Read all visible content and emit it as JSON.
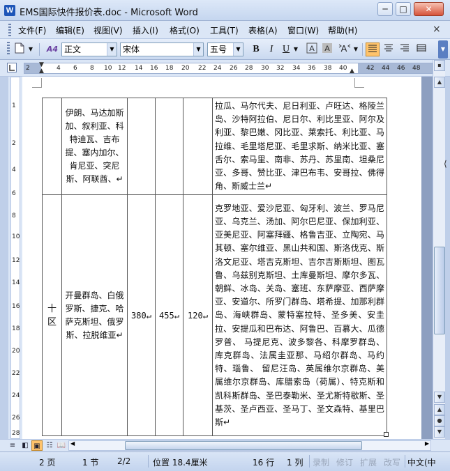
{
  "window": {
    "title": "EMS国际快件报价表.doc - Microsoft Word",
    "app_icon": "W"
  },
  "window_controls": {
    "minimize": "─",
    "maximize": "□",
    "close": "✕"
  },
  "menu": {
    "items": [
      "文件(F)",
      "编辑(E)",
      "视图(V)",
      "插入(I)",
      "格式(O)",
      "工具(T)",
      "表格(A)",
      "窗口(W)",
      "帮助(H)"
    ],
    "close_doc": "×"
  },
  "toolbar": {
    "style_value": "正文",
    "font_value": "宋体",
    "size_value": "五号",
    "bold": "B",
    "italic": "I",
    "underline": "U",
    "styles_icon": "A4"
  },
  "ruler": {
    "h_ticks": [
      "2",
      "2",
      "4",
      "6",
      "8",
      "10",
      "12",
      "14",
      "16",
      "18",
      "20",
      "22",
      "24",
      "26",
      "28",
      "30",
      "32",
      "34",
      "36",
      "38",
      "40",
      "42",
      "44",
      "46",
      "48"
    ],
    "v_ticks": [
      "1",
      "2",
      "4",
      "6",
      "8",
      "10",
      "12",
      "14",
      "16",
      "18",
      "20",
      "22",
      "24",
      "26",
      "28"
    ]
  },
  "table": {
    "row1": {
      "countries": "伊朗、马达加斯加、叙利亚、科特迪瓦、吉布提、塞内加尔、肯尼亚、突尼斯、阿联酋、↵",
      "destinations": "拉瓜、马尔代夫、尼日利亚、卢旺达、格陵兰岛、沙特阿拉伯、尼日尔、利比里亚、阿尔及利亚、黎巴嫩、冈比亚、莱索托、利比亚、马拉维、毛里塔尼亚、毛里求斯、纳米比亚、塞舌尔、索马里、南非、苏丹、苏里南、坦桑尼亚、多哥、赞比亚、津巴布韦、安哥拉、佛得角、斯威士兰↵"
    },
    "row2": {
      "zone": "十区",
      "countries": "开曼群岛、白俄罗斯、捷克、哈萨克斯坦、俄罗斯、拉脱维亚↵",
      "price1": "380↵",
      "price2": "455↵",
      "price3": "120↵",
      "destinations": "克罗地亚、爱沙尼亚、匈牙利、波兰、罗马尼亚、乌克兰、汤加、阿尔巴尼亚、保加利亚、亚美尼亚、阿塞拜疆、格鲁吉亚、立陶宛、马其顿、塞尔维亚、黑山共和国、斯洛伐克、斯洛文尼亚、塔吉克斯坦、吉尔吉斯斯坦、图瓦鲁、乌兹别克斯坦、土库曼斯坦、摩尔多瓦、朝鲜、冰岛、关岛、塞班、东萨摩亚、西萨摩亚、安道尔、所罗门群岛、塔希提、加那利群岛、海峡群岛、蒙特塞拉特、圣多美、安圭拉、安提瓜和巴布达、阿鲁巴、百慕大、瓜德罗普、 马提尼克、波多黎各、科摩罗群岛、库克群岛、法属圭亚那、马绍尔群岛、马约特、瑙鲁、 留尼汪岛、英属维尔京群岛、美属维尔京群岛、库腊索岛（荷属）、特克斯和凯科斯群岛、圣巴泰勒米、圣尤斯特歇斯、圣基茨、圣卢西亚、圣马丁、圣文森特、基里巴斯↵"
    }
  },
  "status": {
    "page": "2 页",
    "section": "1 节",
    "page_of": "2/2",
    "position": "位置 18.4厘米",
    "line": "16 行",
    "column": "1 列",
    "rec": "录制",
    "trk": "修订",
    "ext": "扩展",
    "ovr": "改写",
    "lang": "中文(中"
  }
}
